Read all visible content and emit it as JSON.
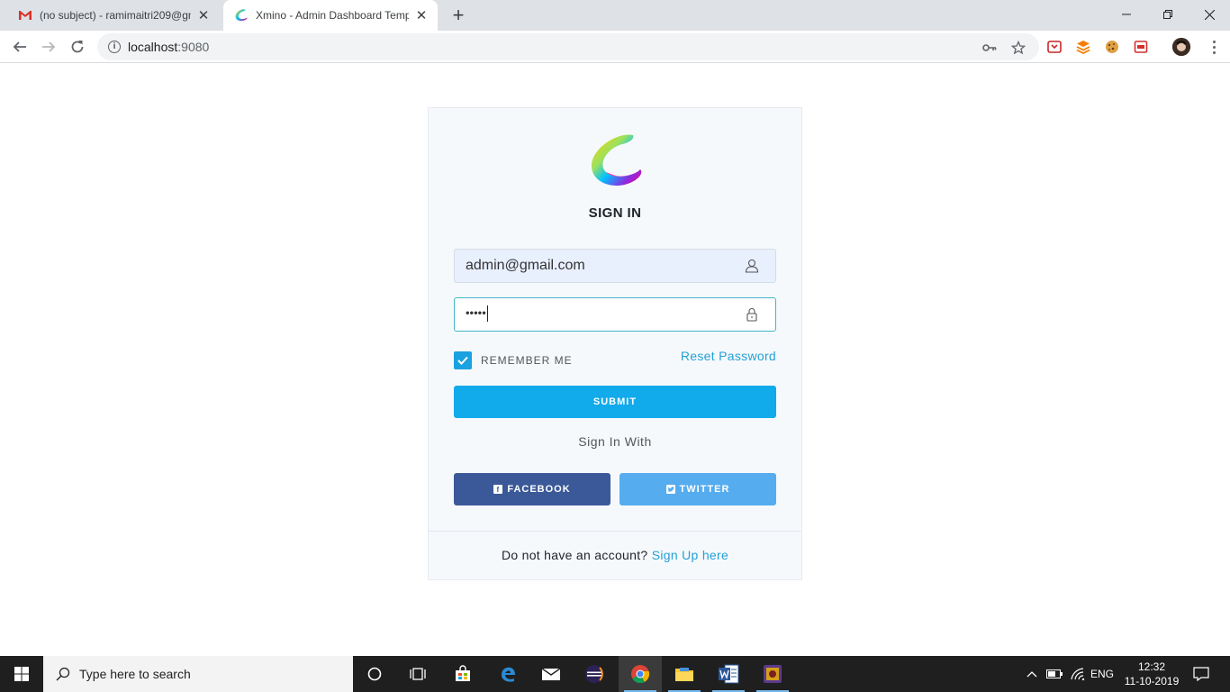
{
  "browser": {
    "tabs": [
      {
        "title": "(no subject) - ramimaitri209@gm",
        "active": false
      },
      {
        "title": "Xmino - Admin Dashboard Temp",
        "active": true
      }
    ],
    "address": {
      "host": "localhost",
      "port": ":9080"
    }
  },
  "login": {
    "title": "SIGN IN",
    "email_value": "admin@gmail.com",
    "password_mask": "•••••",
    "remember_label": "REMEMBER ME",
    "remember_checked": true,
    "reset_link": "Reset Password",
    "submit_label": "SUBMIT",
    "sign_in_with": "Sign In With",
    "facebook_label": "FACEBOOK",
    "twitter_label": "TWITTER",
    "signup_prompt": "Do not have an account?",
    "signup_link": "Sign Up here"
  },
  "taskbar": {
    "search_placeholder": "Type here to search",
    "language": "ENG",
    "time": "12:32",
    "date": "11-10-2019"
  },
  "colors": {
    "primary": "#11aaeb",
    "facebook": "#3b5998",
    "twitter": "#55acee",
    "link": "#24a0d6"
  }
}
